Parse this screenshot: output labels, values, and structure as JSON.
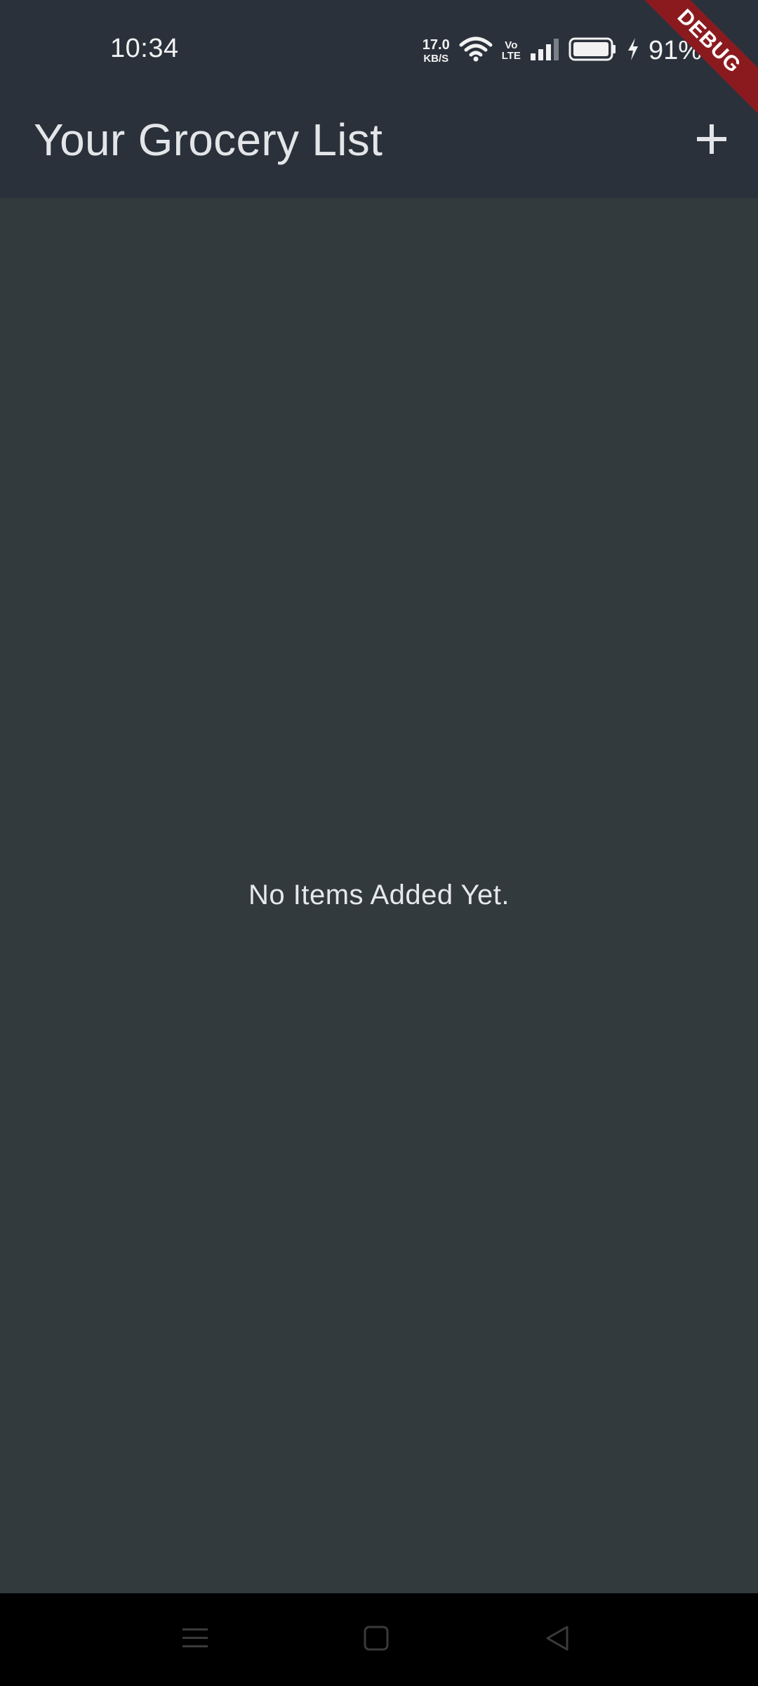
{
  "status_bar": {
    "time": "10:34",
    "net_speed_value": "17.0",
    "net_speed_unit": "KB/S",
    "volte_top": "Vo",
    "volte_bottom": "LTE",
    "battery_percent": "91%"
  },
  "app_bar": {
    "title": "Your Grocery List",
    "add_icon": "plus-icon"
  },
  "main": {
    "empty_message": "No Items Added Yet."
  },
  "debug_banner": {
    "label": "DEBUG"
  },
  "nav_bar": {
    "icons": [
      "menu-icon",
      "home-icon",
      "back-icon"
    ]
  },
  "colors": {
    "app_bar_bg": "#2a313b",
    "body_bg": "#333a3d",
    "debug_ribbon": "#8b1a1f",
    "nav_bar_bg": "#000000"
  }
}
